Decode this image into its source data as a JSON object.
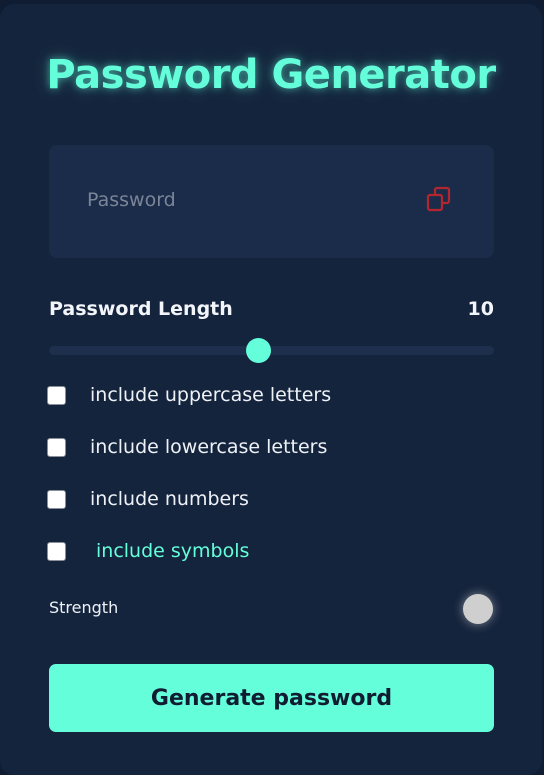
{
  "app": {
    "title": "Password Generator"
  },
  "password_field": {
    "value": "",
    "placeholder": "Password",
    "copy_icon": "copy-icon"
  },
  "length": {
    "label": "Password Length",
    "value": "10",
    "slider_fraction": 0.47
  },
  "options": [
    {
      "label": "include uppercase letters",
      "checked": false
    },
    {
      "label": "include lowercase letters",
      "checked": false
    },
    {
      "label": "include numbers",
      "checked": false
    },
    {
      "label": "include symbols",
      "checked": false
    }
  ],
  "strength": {
    "label": "Strength",
    "indicator_color": "#cfcfcf"
  },
  "generate_button": {
    "label": "Generate password"
  },
  "colors": {
    "accent": "#64ffda",
    "background": "#0f1c31",
    "card": "#15243d",
    "input_bg": "#1a2c4a",
    "copy_icon": "#b3262f"
  }
}
